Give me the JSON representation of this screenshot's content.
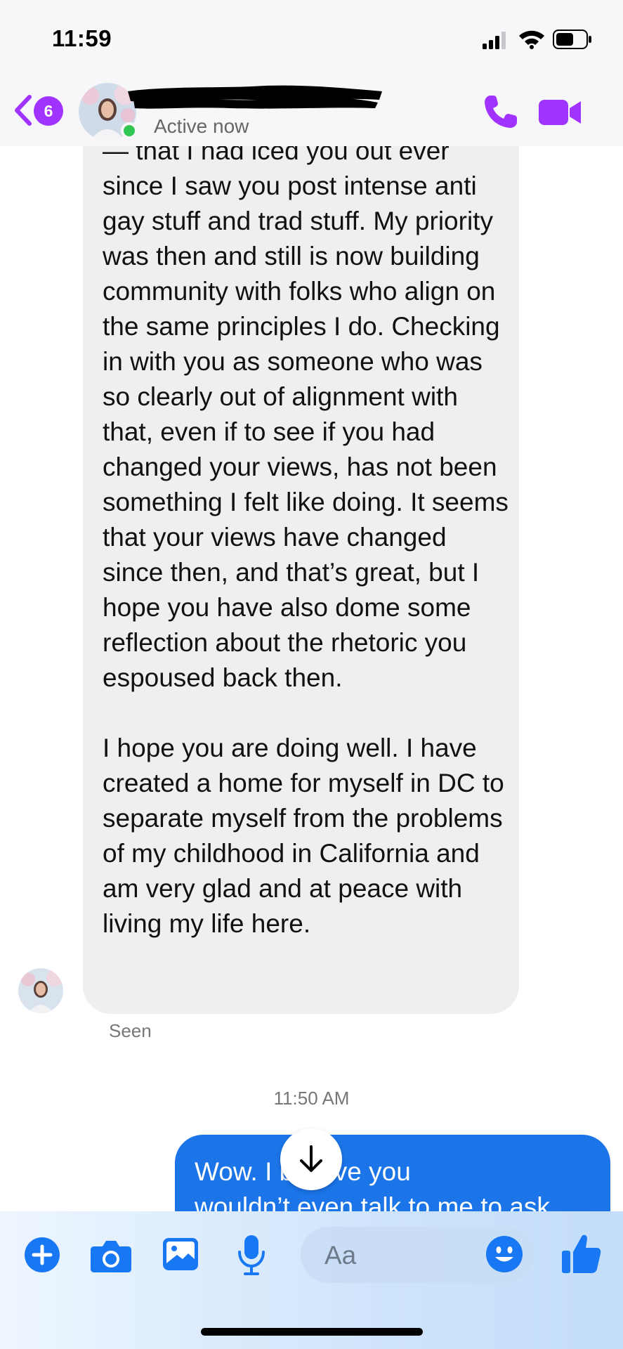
{
  "status_bar": {
    "time": "11:59"
  },
  "header": {
    "back_badge_count": "6",
    "active_status": "Active now"
  },
  "messages": {
    "incoming_text": "— that I had iced you out ever since I saw you post intense anti gay stuff and trad stuff. My priority was then and still is now building community with folks who align on the same principles I do. Checking in with you as someone who was so clearly out of alignment with that, even if to see if you had changed your views, has not been something I felt like doing. It seems that your views have changed since then, and that’s great, but I hope you have also dome some reflection about the rhetoric you espoused back then.\n\nI hope you are doing well. I have created a home for myself in DC to separate myself from the problems of my childhood in California and am very glad and at peace with living my life here.",
    "seen_label": "Seen",
    "timestamp": "11:50 AM",
    "outgoing_text": "Wow. I      believe you\nwouldn’t even talk to me to ask"
  },
  "composer": {
    "placeholder": "Aa"
  },
  "colors": {
    "accent_purple": "#a033ff",
    "outgoing_blue": "#1b74e8",
    "incoming_gray": "#efeff0",
    "composer_icon_blue": "#1877f2",
    "online_green": "#31c552"
  },
  "icons": [
    "signal-icon",
    "wifi-icon",
    "battery-icon",
    "back-chevron-icon",
    "phone-call-icon",
    "video-call-icon",
    "arrow-down-icon",
    "plus-icon",
    "camera-icon",
    "gallery-icon",
    "microphone-icon",
    "emoji-icon",
    "thumbs-up-icon"
  ]
}
